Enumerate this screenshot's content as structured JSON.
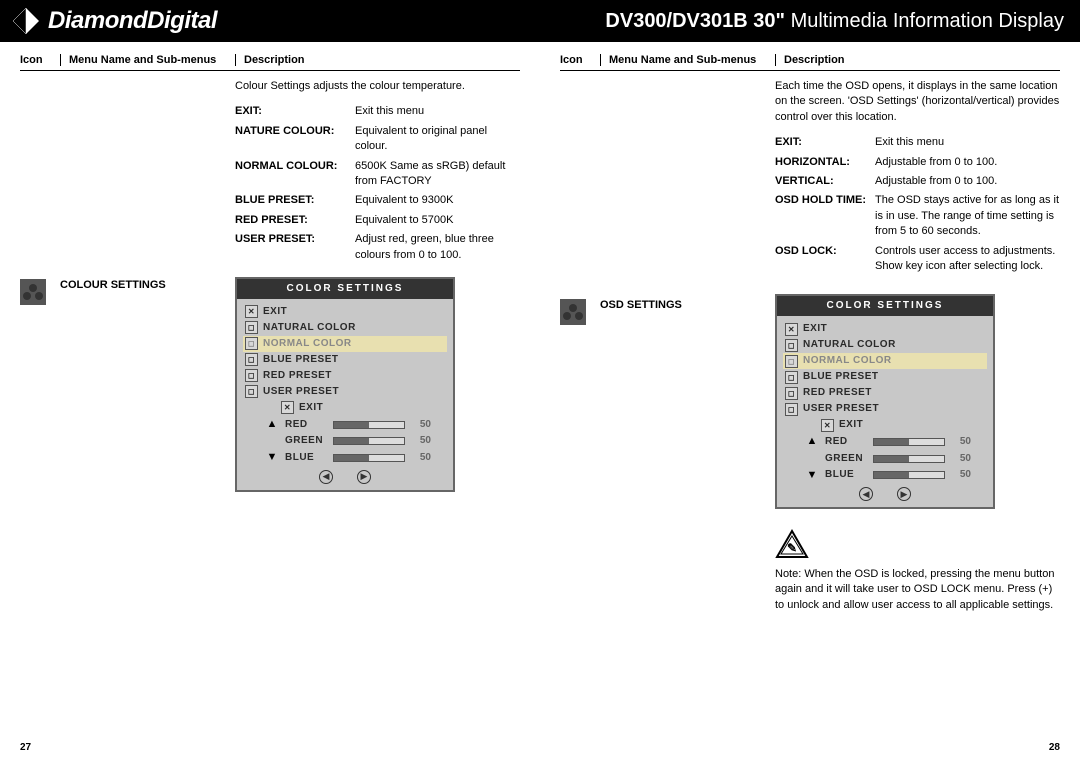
{
  "header": {
    "brand": "DiamondDigital",
    "model": "DV300/DV301B 30\"",
    "product_suffix": "Multimedia Information Display"
  },
  "column_headers": {
    "icon": "Icon",
    "menu": "Menu Name and Sub-menus",
    "desc": "Description"
  },
  "left": {
    "menu_name": "COLOUR SETTINGS",
    "intro": "Colour Settings adjusts the colour temperature.",
    "terms": [
      {
        "label": "EXIT:",
        "val": "Exit this menu"
      },
      {
        "label": "NATURE COLOUR:",
        "val": "Equivalent to original panel colour."
      },
      {
        "label": "NORMAL COLOUR:",
        "val": "6500K Same as sRGB) default from FACTORY"
      },
      {
        "label": "BLUE PRESET:",
        "val": "Equivalent to 9300K"
      },
      {
        "label": "RED PRESET:",
        "val": "Equivalent to 5700K"
      },
      {
        "label": "USER PRESET:",
        "val": "Adjust red, green, blue three colours from 0 to 100."
      }
    ],
    "osd": {
      "title": "COLOR SETTINGS",
      "items": [
        "EXIT",
        "NATURAL COLOR",
        "NORMAL COLOR",
        "BLUE PRESET",
        "RED PRESET",
        "USER PRESET"
      ],
      "sub_exit": "EXIT",
      "sliders": [
        {
          "sym": "▲",
          "label": "RED",
          "val": "50"
        },
        {
          "sym": "",
          "label": "GREEN",
          "val": "50"
        },
        {
          "sym": "▼",
          "label": "BLUE",
          "val": "50"
        }
      ]
    },
    "page": "27"
  },
  "right": {
    "menu_name": "OSD SETTINGS",
    "intro": "Each time the OSD opens, it displays in the same location on the screen. 'OSD Settings' (horizontal/vertical) provides control over this location.",
    "terms": [
      {
        "label": "EXIT:",
        "val": "Exit this menu"
      },
      {
        "label": "HORIZONTAL:",
        "val": "Adjustable from 0 to 100."
      },
      {
        "label": "VERTICAL:",
        "val": "Adjustable from 0 to 100."
      },
      {
        "label": "OSD HOLD TIME:",
        "val": "The OSD stays active for as long as it is in use. The range of time setting is from 5 to 60 seconds."
      },
      {
        "label": "OSD LOCK:",
        "val": "Controls user access to adjustments. Show key icon after selecting lock."
      }
    ],
    "osd": {
      "title": "COLOR SETTINGS",
      "items": [
        "EXIT",
        "NATURAL COLOR",
        "NORMAL COLOR",
        "BLUE PRESET",
        "RED PRESET",
        "USER PRESET"
      ],
      "sub_exit": "EXIT",
      "sliders": [
        {
          "sym": "▲",
          "label": "RED",
          "val": "50"
        },
        {
          "sym": "",
          "label": "GREEN",
          "val": "50"
        },
        {
          "sym": "▼",
          "label": "BLUE",
          "val": "50"
        }
      ]
    },
    "note_label": "Note:",
    "note_text": "When the OSD is locked, pressing the menu button again and it will take user to OSD LOCK menu. Press (+) to unlock and allow user access to all applicable settings.",
    "page": "28"
  }
}
